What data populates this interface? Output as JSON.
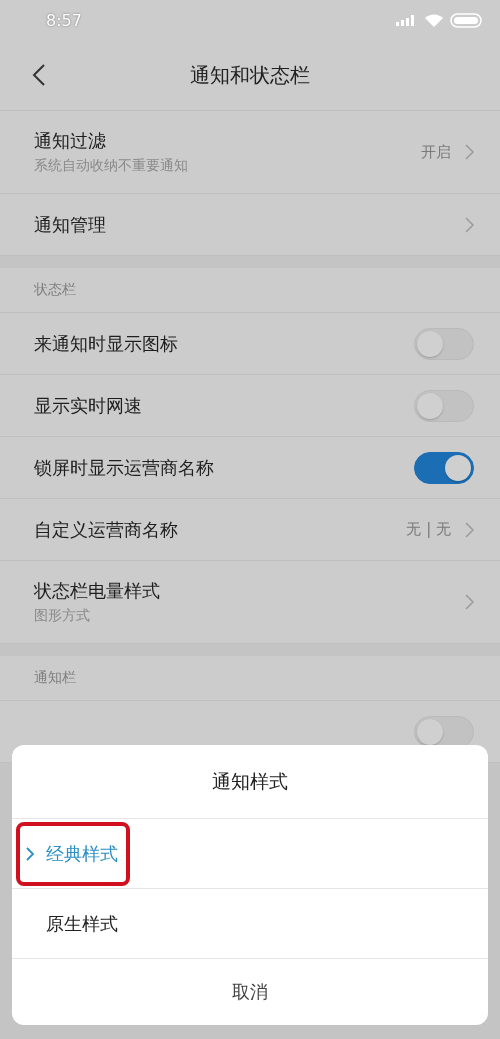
{
  "status_bar": {
    "time": "8:57"
  },
  "header": {
    "title": "通知和状态栏"
  },
  "groups": [
    {
      "items": [
        {
          "kind": "link",
          "label": "通知过滤",
          "subtitle": "系统自动收纳不重要通知",
          "value": "开启"
        },
        {
          "kind": "link",
          "label": "通知管理"
        }
      ]
    },
    {
      "header": "状态栏",
      "items": [
        {
          "kind": "toggle",
          "label": "来通知时显示图标",
          "on": false
        },
        {
          "kind": "toggle",
          "label": "显示实时网速",
          "on": false
        },
        {
          "kind": "toggle",
          "label": "锁屏时显示运营商名称",
          "on": true
        },
        {
          "kind": "link",
          "label": "自定义运营商名称",
          "value": "无 | 无"
        },
        {
          "kind": "link",
          "label": "状态栏电量样式",
          "subtitle": "图形方式"
        }
      ]
    },
    {
      "header": "通知栏",
      "items": [
        {
          "kind": "toggle",
          "on": false
        }
      ]
    }
  ],
  "dialog": {
    "title": "通知样式",
    "options": [
      {
        "label": "经典样式",
        "selected": true,
        "highlighted": true
      },
      {
        "label": "原生样式",
        "selected": false,
        "highlighted": false
      }
    ],
    "cancel": "取消"
  }
}
